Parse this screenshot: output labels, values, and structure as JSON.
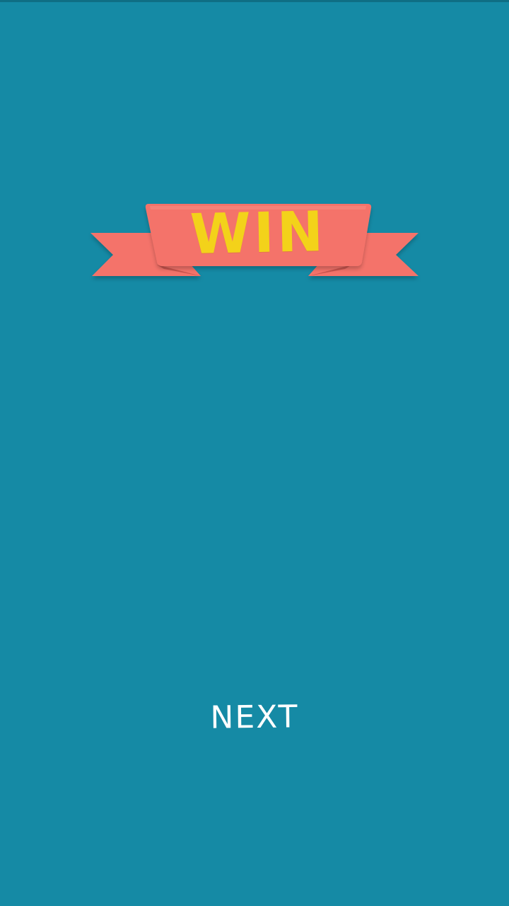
{
  "screen": {
    "background_color": "#158aa5",
    "status_strip_color": "#0f6e84"
  },
  "banner": {
    "title": "WIN",
    "ribbon_color": "#f4736a",
    "ribbon_shade_color": "#e0625b",
    "title_color": "#f3d21a"
  },
  "actions": {
    "next_label": "NEXT",
    "next_color": "#ffffff"
  }
}
